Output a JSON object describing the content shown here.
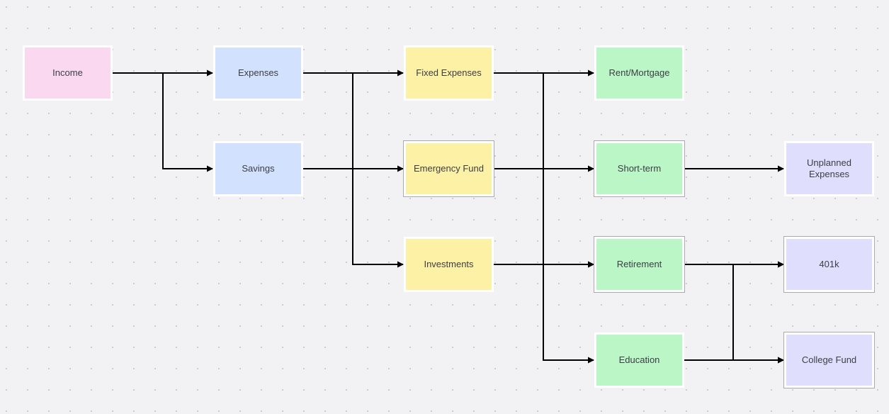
{
  "diagram": {
    "colors": {
      "income": "#f9d8f0",
      "level1": "#d2e1fd",
      "level2": "#fdf1a6",
      "level3": "#bbf7c6",
      "level4": "#dfdffd",
      "edge": "#000000"
    },
    "nodes": [
      {
        "id": "income",
        "label": "Income",
        "col": 0,
        "row": 0,
        "color": "income"
      },
      {
        "id": "expenses",
        "label": "Expenses",
        "col": 1,
        "row": 0,
        "color": "level1"
      },
      {
        "id": "savings",
        "label": "Savings",
        "col": 1,
        "row": 1,
        "color": "level1"
      },
      {
        "id": "fixed-expenses",
        "label": "Fixed Expenses",
        "col": 2,
        "row": 0,
        "color": "level2"
      },
      {
        "id": "emergency-fund",
        "label": "Emergency Fund",
        "col": 2,
        "row": 1,
        "color": "level2",
        "outlined": true
      },
      {
        "id": "investments",
        "label": "Investments",
        "col": 2,
        "row": 2,
        "color": "level2"
      },
      {
        "id": "rent-mortgage",
        "label": "Rent/Mortgage",
        "col": 3,
        "row": 0,
        "color": "level3"
      },
      {
        "id": "short-term",
        "label": "Short-term",
        "col": 3,
        "row": 1,
        "color": "level3",
        "outlined": true
      },
      {
        "id": "retirement",
        "label": "Retirement",
        "col": 3,
        "row": 2,
        "color": "level3",
        "outlined": true
      },
      {
        "id": "education",
        "label": "Education",
        "col": 3,
        "row": 3,
        "color": "level3"
      },
      {
        "id": "unplanned-expenses",
        "label": "Unplanned Expenses",
        "col": 4,
        "row": 1,
        "color": "level4"
      },
      {
        "id": "401k",
        "label": "401k",
        "col": 4,
        "row": 2,
        "color": "level4",
        "outlined": true
      },
      {
        "id": "college-fund",
        "label": "College Fund",
        "col": 4,
        "row": 3,
        "color": "level4",
        "outlined": true
      }
    ],
    "edges": [
      {
        "from": "income",
        "to": "expenses"
      },
      {
        "from": "income",
        "to": "savings"
      },
      {
        "from": "expenses",
        "to": "fixed-expenses"
      },
      {
        "from": "expenses",
        "to": "investments"
      },
      {
        "from": "savings",
        "to": "emergency-fund"
      },
      {
        "from": "fixed-expenses",
        "to": "rent-mortgage"
      },
      {
        "from": "fixed-expenses",
        "to": "retirement"
      },
      {
        "from": "fixed-expenses",
        "to": "education"
      },
      {
        "from": "emergency-fund",
        "to": "short-term"
      },
      {
        "from": "investments",
        "to": "retirement"
      },
      {
        "from": "short-term",
        "to": "unplanned-expenses"
      },
      {
        "from": "retirement",
        "to": "401k"
      },
      {
        "from": "retirement",
        "to": "college-fund"
      },
      {
        "from": "education",
        "to": "college-fund"
      },
      {
        "from": "education",
        "to": "401k"
      }
    ]
  }
}
